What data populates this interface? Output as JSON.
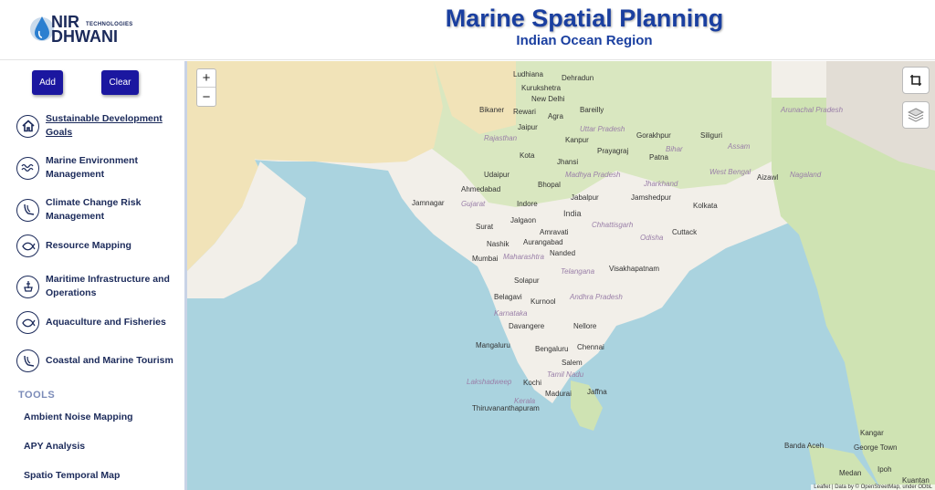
{
  "brand": {
    "line1": "NIR",
    "tag": "TECHNOLOGIES",
    "line2": "DHWANI"
  },
  "header": {
    "title": "Marine Spatial Planning",
    "subtitle": "Indian Ocean Region"
  },
  "sidebar": {
    "add_label": "Add",
    "clear_label": "Clear",
    "items": [
      {
        "label": "Sustainable Development Goals",
        "icon": "home-icon"
      },
      {
        "label": "Marine Environment Management",
        "icon": "waves-icon"
      },
      {
        "label": "Climate Change Risk Management",
        "icon": "coast-icon"
      },
      {
        "label": "Resource Mapping",
        "icon": "fish-icon"
      },
      {
        "label": "Maritime Infrastructure and Operations",
        "icon": "ship-icon"
      },
      {
        "label": "Aquaculture and Fisheries",
        "icon": "fish-icon"
      },
      {
        "label": "Coastal and Marine Tourism",
        "icon": "coast-icon"
      }
    ],
    "tools_heading": "TOOLS",
    "tools": [
      "Ambient Noise Mapping",
      "APY Analysis",
      "Spatio Temporal Map"
    ]
  },
  "map": {
    "zoom_in": "+",
    "zoom_out": "−",
    "attribution": "Leaflet | Data by © OpenStreetMap, under ODbL",
    "colors": {
      "sea": "#aad3df",
      "land": "#f2efe9",
      "green": "#cfe3b3",
      "desert": "#f1e3b8"
    },
    "labels": [
      "Ludhiana",
      "Dehradun",
      "Kurukshetra",
      "New Delhi",
      "Bikaner",
      "Rewari",
      "Bareilly",
      "Agra",
      "Jaipur",
      "Uttar Pradesh",
      "Kanpur",
      "Gorakhpur",
      "Siliguri",
      "Rajasthan",
      "Prayagraj",
      "Kota",
      "Jhansi",
      "Patna",
      "Bihar",
      "Udaipur",
      "Madhya Pradesh",
      "Bhopal",
      "Jharkhand",
      "West Bengal",
      "Ahmedabad",
      "Jabalpur",
      "Jamshedpur",
      "Gujarat",
      "Indore",
      "India",
      "Kolkata",
      "Jamnagar",
      "Surat",
      "Jalgaon",
      "Chhattisgarh",
      "Odisha",
      "Amravati",
      "Cuttack",
      "Nashik",
      "Aurangabad",
      "Nanded",
      "Mumbai",
      "Maharashtra",
      "Telangana",
      "Visakhapatnam",
      "Solapur",
      "Belagavi",
      "Kurnool",
      "Andhra Pradesh",
      "Karnataka",
      "Davangere",
      "Nellore",
      "Mangaluru",
      "Bengaluru",
      "Chennai",
      "Salem",
      "Tamil Nadu",
      "Lakshadweep",
      "Kochi",
      "Madurai",
      "Jaffna",
      "Thiruvananthapuram",
      "Kerala",
      "Arunachal Pradesh",
      "Assam",
      "Aizawl",
      "Banda Aceh",
      "George Town",
      "Medan",
      "Kangar",
      "Ipoh",
      "Kuantan",
      "Nagaland"
    ]
  }
}
